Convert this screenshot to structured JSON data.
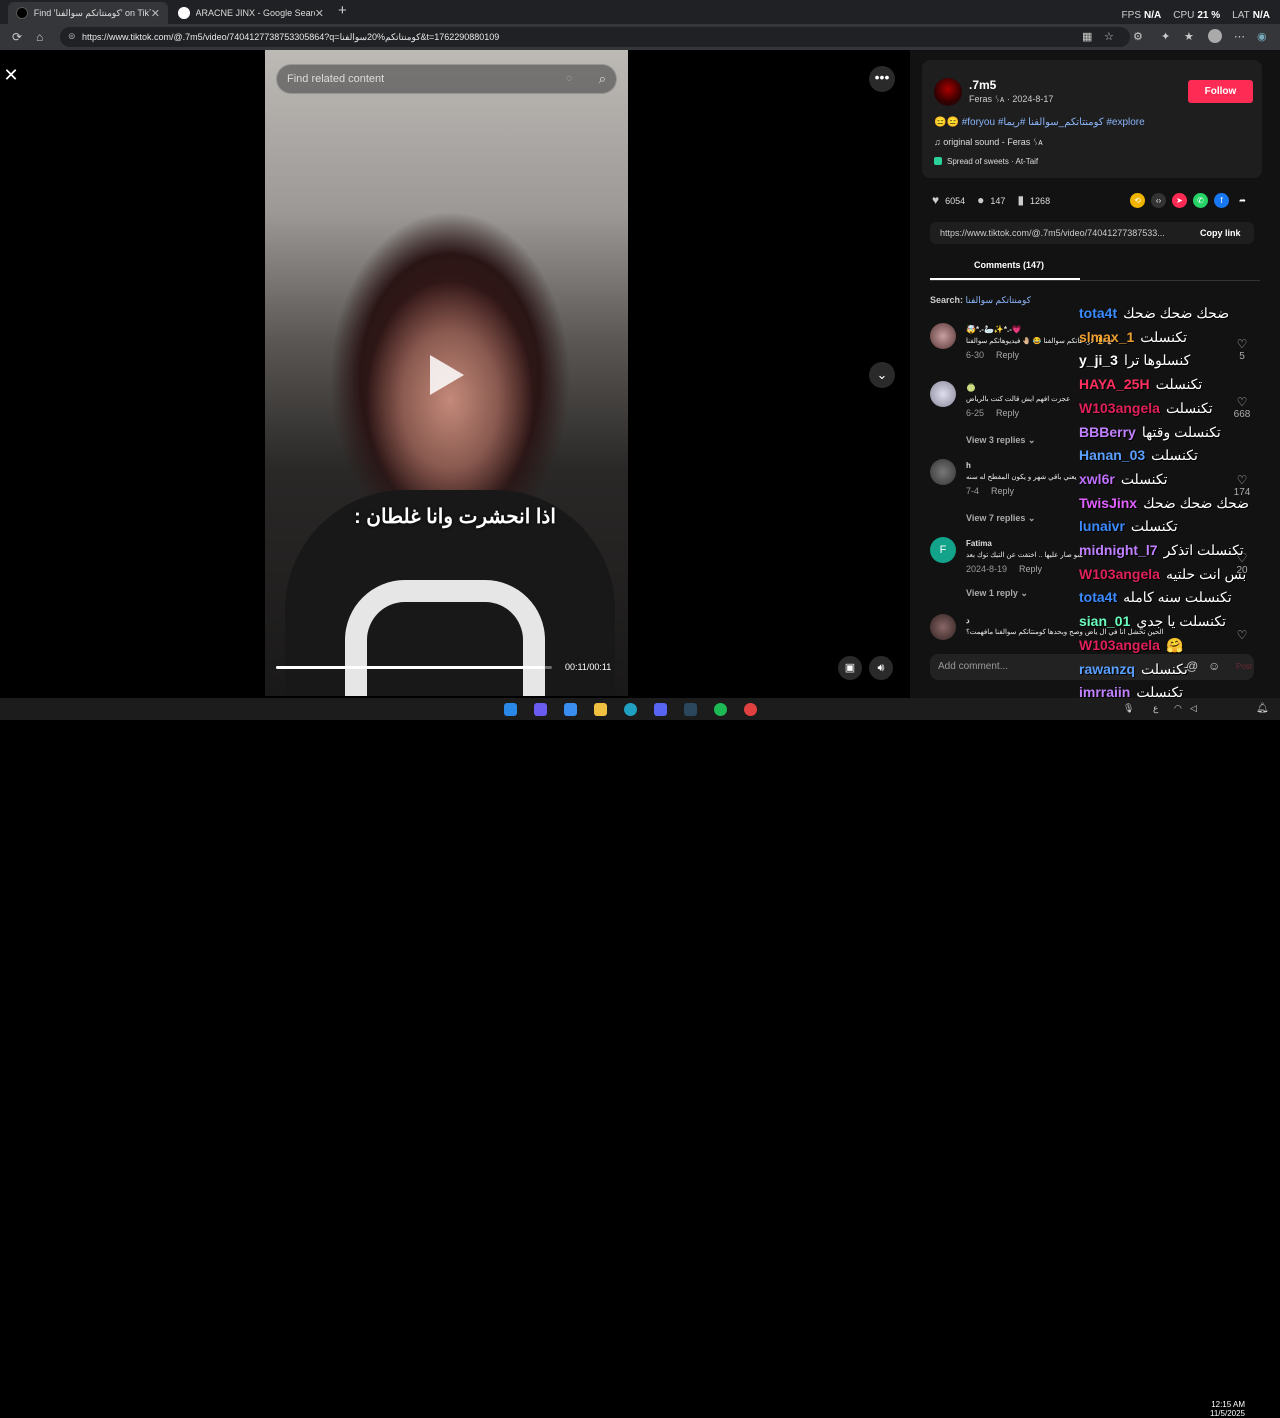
{
  "browser": {
    "tabs": [
      {
        "title": "Find 'كومنتاتكم سوالفنا' on TikTok"
      },
      {
        "title": "ARACNE JINX - Google Search"
      }
    ],
    "url": "https://www.tiktok.com/@.7m5/video/7404127738753305864?q=كومنتاتكم%20سوالفنا&t=1762290880109",
    "stats": {
      "fps_label": "FPS",
      "fps": "N/A",
      "cpu_label": "CPU",
      "cpu": "21 %",
      "lat_label": "LAT",
      "lat": "N/A"
    }
  },
  "video": {
    "search_placeholder": "Find related content",
    "caption": "اذا انحشرت وانا غلطان :",
    "timecode": "00:11/00:11",
    "progress": 0.97
  },
  "author": {
    "handle": ".7m5",
    "subtitle": "Feras ᛊᴀ · 2024-8-17",
    "follow_label": "Follow",
    "description_emoji": "😑😑",
    "description_tags": "#foryou #كومنتاتكم_سوالفنا #ريما #explore",
    "music": "♫  original sound - Feras ᛊᴀ",
    "place": "Spread of sweets · At-Taif"
  },
  "stats": {
    "likes": "6054",
    "comments": "147",
    "saves": "1268"
  },
  "share_link": "https://www.tiktok.com/@.7m5/video/74041277387533...",
  "copy_link_label": "Copy link",
  "comments_tab_label": "Comments (147)",
  "search_label": "Search:",
  "search_query": "كومنتاتكم سوالفنا",
  "comments": [
    {
      "name": "🤯*.-🦢✨*.-💗",
      "text": "كومنتاتكم سوالفنا 😂 🤚🏼 فيديوهاتكم سوالفنا 😂🤚🏼",
      "date": "6-30",
      "reply": "Reply",
      "likes": "5"
    },
    {
      "name": "🍈",
      "text": "عجزت افهم ايش قالت كنت بالرياض",
      "date": "6-25",
      "reply": "Reply",
      "likes": "668",
      "view_replies": "View 3 replies"
    },
    {
      "name": "h",
      "text": "يعني باقي شهر و يكون المفطح له سنه",
      "date": "7-4",
      "reply": "Reply",
      "likes": "174",
      "view_replies": "View 7 replies"
    },
    {
      "name": "Fatima",
      "text": "شو صار عليها .. اختفت عن التيك توك بعد",
      "date": "2024-8-19",
      "reply": "Reply",
      "likes": "20",
      "view_replies": "View 1 reply"
    },
    {
      "name": "د",
      "text": "الحين تحشل انا في ال ياض وصح وبحدها كومنتاتكم سوالفنا مافهمت؟",
      "date": "",
      "reply": "",
      "likes": ""
    }
  ],
  "comment_placeholder": "Add comment...",
  "post_label": "Post",
  "chat": [
    {
      "user": "tota4t",
      "msg": "ضحك ضحك ضحك",
      "color": "#3b8bff"
    },
    {
      "user": "slmax_1",
      "msg": "تكنسلت",
      "color": "#f0a030"
    },
    {
      "user": "y_ji_3",
      "msg": "كنسلوها ترا",
      "color": "#ffffff"
    },
    {
      "user": "HAYA_25H",
      "msg": "تكنسلت",
      "color": "#ff3060"
    },
    {
      "user": "W103angela",
      "msg": "تكنسلت",
      "color": "#e0205a"
    },
    {
      "user": "BBBerry",
      "msg": "تكنسلت وقتها",
      "color": "#c080ff"
    },
    {
      "user": "Hanan_03",
      "msg": "تكنسلت",
      "color": "#5aa0ff"
    },
    {
      "user": "xwl6r",
      "msg": "تكنسلت",
      "color": "#c070ff"
    },
    {
      "user": "TwisJinx",
      "msg": "ضحك ضحك ضحك",
      "color": "#e060ff"
    },
    {
      "user": "lunaivr",
      "msg": "تكنسلت",
      "color": "#3b8bff"
    },
    {
      "user": "midnight_l7",
      "msg": "تكنسلت اتذكر",
      "color": "#c080ff"
    },
    {
      "user": "W103angela",
      "msg": "بس انت حلتيه",
      "color": "#e0205a"
    },
    {
      "user": "tota4t",
      "msg": "تكنسلت سنه كامله",
      "color": "#3b8bff"
    },
    {
      "user": "sian_01",
      "msg": "تكنسلت يا جدي",
      "color": "#6affc0"
    },
    {
      "user": "W103angela",
      "msg": "🤗",
      "color": "#e0205a"
    },
    {
      "user": "rawanzq",
      "msg": "تكنسلت",
      "color": "#5aa0ff"
    },
    {
      "user": "imrraiin",
      "msg": "تكنسلت",
      "color": "#c080ff"
    }
  ],
  "clock": {
    "time": "12:15 AM",
    "date": "11/5/2025"
  }
}
